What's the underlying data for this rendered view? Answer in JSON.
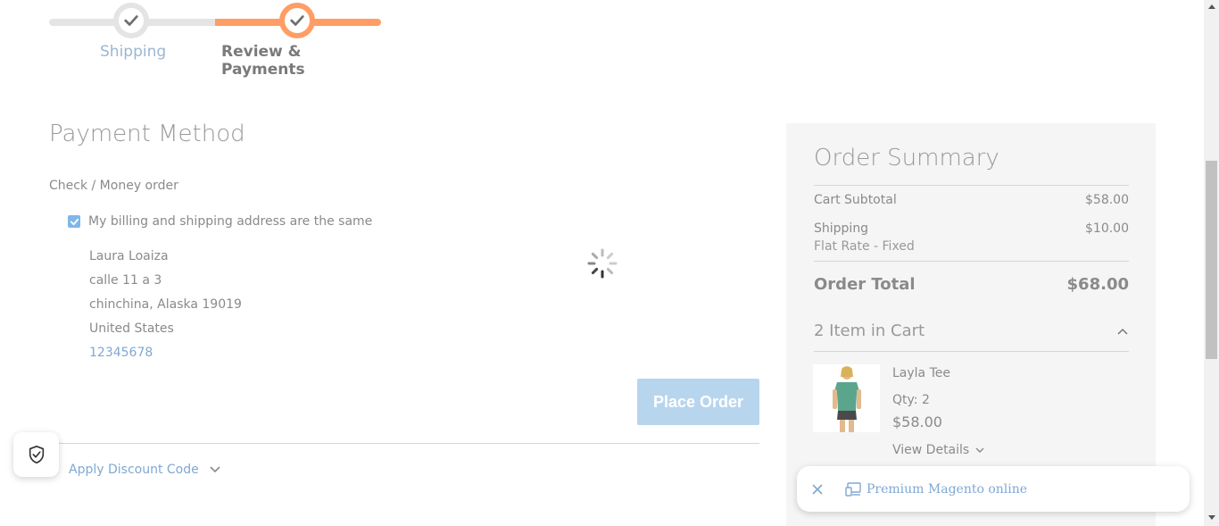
{
  "progress": {
    "steps": [
      {
        "label": "Shipping",
        "status": "done"
      },
      {
        "label": "Review & Payments",
        "status": "active"
      }
    ],
    "accent_color": "#ff9d64"
  },
  "payment": {
    "title": "Payment Method",
    "method_label": "Check / Money order",
    "same_address_label": "My billing and shipping address are the same",
    "same_address_checked": true,
    "address": {
      "name": "Laura Loaiza",
      "street": "calle 11 a 3",
      "city_line": "chinchina, Alaska 19019",
      "country": "United States",
      "phone": "12345678"
    },
    "place_order_label": "Place Order",
    "discount_label": "Apply Discount Code"
  },
  "summary": {
    "title": "Order Summary",
    "cart_subtotal_label": "Cart Subtotal",
    "cart_subtotal_value": "$58.00",
    "shipping_label": "Shipping",
    "shipping_value": "$10.00",
    "shipping_method": "Flat Rate - Fixed",
    "order_total_label": "Order Total",
    "order_total_value": "$68.00",
    "cart_count_label": "2 Item in Cart",
    "items": [
      {
        "name": "Layla Tee",
        "qty": "Qty: 2",
        "price": "$58.00",
        "details_label": "View Details"
      }
    ]
  },
  "promo": {
    "text": "Premium Magento online"
  },
  "icons": {
    "step_done": "check-icon",
    "step_active": "check-icon",
    "loading": "spinner-icon",
    "shield": "shield-check-icon",
    "promo_close": "close-icon",
    "promo_device": "devices-icon"
  }
}
